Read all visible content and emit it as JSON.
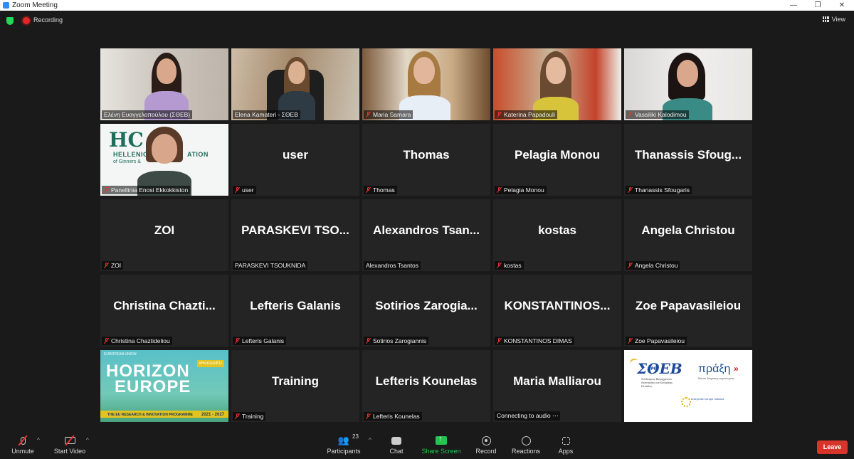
{
  "window": {
    "title": "Zoom Meeting",
    "controls": [
      "—",
      "❐",
      "✕"
    ]
  },
  "topbar": {
    "recording_label": "Recording",
    "view_label": "View"
  },
  "tiles": [
    {
      "display_name": "",
      "label": "Ελένη Ευαγγελοπούλου (ΣΘΕΒ)",
      "type": "video",
      "muted": false,
      "active": true
    },
    {
      "display_name": "",
      "label": "Elena Kamateri - ΣΘΕΒ",
      "type": "video",
      "muted": false
    },
    {
      "display_name": "",
      "label": "Maria Samara",
      "type": "video",
      "muted": true
    },
    {
      "display_name": "",
      "label": "Katerina Papadouli",
      "type": "video",
      "muted": true
    },
    {
      "display_name": "",
      "label": "Vassiliki Kalodimou",
      "type": "video",
      "muted": true
    },
    {
      "display_name": "",
      "label": "Panellinia Enosi Ekkokkiston",
      "type": "video",
      "muted": true
    },
    {
      "display_name": "user",
      "label": "user",
      "type": "name",
      "muted": true
    },
    {
      "display_name": "Thomas",
      "label": "Thomas",
      "type": "name",
      "muted": true
    },
    {
      "display_name": "Pelagia Monou",
      "label": "Pelagia Monou",
      "type": "name",
      "muted": true
    },
    {
      "display_name": "Thanassis  Sfoug...",
      "label": "Thanassis Sfougaris",
      "type": "name",
      "muted": true
    },
    {
      "display_name": "ZOI",
      "label": "ZOI",
      "type": "name",
      "muted": true
    },
    {
      "display_name": "PARASKEVI  TSO...",
      "label": "PARASKEVI TSOUKNIDA",
      "type": "name",
      "muted": false
    },
    {
      "display_name": "Alexandros  Tsan...",
      "label": "Alexandros Tsantos",
      "type": "name",
      "muted": false
    },
    {
      "display_name": "kostas",
      "label": "kostas",
      "type": "name",
      "muted": true
    },
    {
      "display_name": "Angela Christou",
      "label": "Angela Christou",
      "type": "name",
      "muted": true
    },
    {
      "display_name": "Christina  Chazti...",
      "label": "Christina Chaztideliou",
      "type": "name",
      "muted": true
    },
    {
      "display_name": "Lefteris Galanis",
      "label": "Lefteris Galanis",
      "type": "name",
      "muted": true
    },
    {
      "display_name": "Sotirios  Zarogia...",
      "label": "Sotirios Zarogiannis",
      "type": "name",
      "muted": true
    },
    {
      "display_name": "KONSTANTINOS...",
      "label": "KONSTANTINOS DIMAS",
      "type": "name",
      "muted": true
    },
    {
      "display_name": "Zoe Papavasileiou",
      "label": "Zoe Papavasileiou",
      "type": "name",
      "muted": true
    },
    {
      "display_name": "",
      "label": "",
      "type": "horizon",
      "muted": false
    },
    {
      "display_name": "Training",
      "label": "Training",
      "type": "name",
      "muted": true
    },
    {
      "display_name": "Lefteris Kounelas",
      "label": "Lefteris Kounelas",
      "type": "name",
      "muted": true
    },
    {
      "display_name": "Maria Malliarou",
      "label": "Connecting to audio ⋯",
      "type": "name",
      "muted": false
    },
    {
      "display_name": "",
      "label": "",
      "type": "logos",
      "muted": false
    }
  ],
  "panellinia_logo": {
    "mark": "HC",
    "text1": "HELLENIC",
    "text2": "ATION",
    "text3": "of Ginners &"
  },
  "horizon": {
    "eu": "EUROPEAN UNION",
    "word1": "HORIZON",
    "word2": "EUROPE",
    "hashtag": "#HorizonEU",
    "programme": "THE EU RESEARCH & INNOVATION PROGRAMME",
    "years": "2021 - 2027"
  },
  "logos": {
    "sthev": "ΣΘΕΒ",
    "sthev_sub": "Σύνδεσμος Βιομηχανιών Θεσσαλίας και Κεντρικής Ελλάδος",
    "praxi": "πράξη",
    "praxi_sub": "δίκτυο διάχυσης τεχνολογίας",
    "een": "enterprise europe network"
  },
  "toolbar": {
    "unmute": "Unmute",
    "start_video": "Start Video",
    "participants": "Participants",
    "participant_count": "23",
    "chat": "Chat",
    "share_screen": "Share Screen",
    "record": "Record",
    "reactions": "Reactions",
    "apps": "Apps",
    "leave": "Leave"
  },
  "colors": {
    "accent_green": "#23c552",
    "leave_red": "#d8352a",
    "active_speaker": "#e6e33a",
    "muted_red": "#e33"
  }
}
